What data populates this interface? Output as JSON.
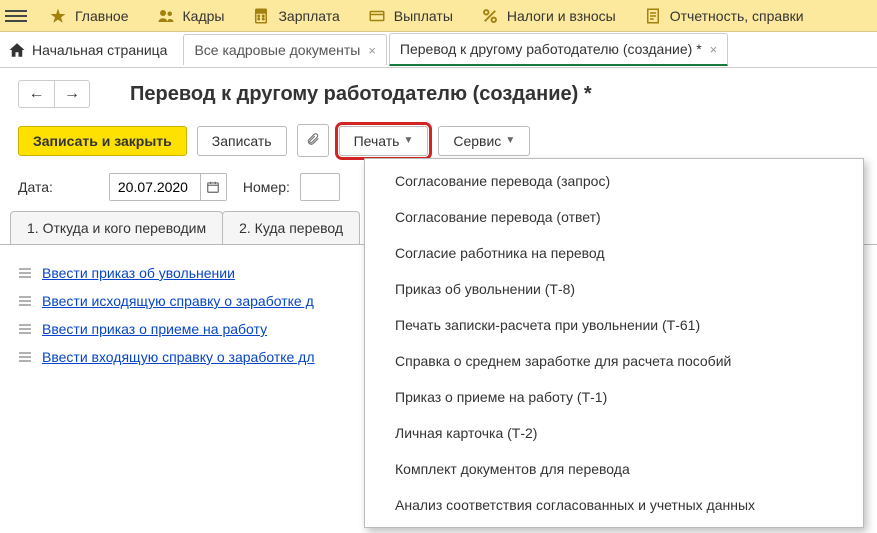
{
  "topmenu": {
    "items": [
      {
        "label": "Главное"
      },
      {
        "label": "Кадры"
      },
      {
        "label": "Зарплата"
      },
      {
        "label": "Выплаты"
      },
      {
        "label": "Налоги и взносы"
      },
      {
        "label": "Отчетность, справки"
      }
    ]
  },
  "tabs": {
    "start": "Начальная страница",
    "items": [
      {
        "label": "Все кадровые документы"
      },
      {
        "label": "Перевод к другому работодателю (создание) *"
      }
    ]
  },
  "page": {
    "title": "Перевод к другому работодателю (создание) *"
  },
  "toolbar": {
    "save_close": "Записать и закрыть",
    "save": "Записать",
    "print": "Печать",
    "service": "Сервис"
  },
  "form": {
    "date_label": "Дата:",
    "date_value": "20.07.2020",
    "number_label": "Номер:",
    "number_value": ""
  },
  "content_tabs": {
    "items": [
      {
        "label": "1. Откуда и кого переводим"
      },
      {
        "label": "2. Куда перевод"
      }
    ]
  },
  "links": {
    "items": [
      {
        "label": "Ввести приказ об увольнении"
      },
      {
        "label": "Ввести исходящую справку о заработке д"
      },
      {
        "label": "Ввести приказ о приеме на работу"
      },
      {
        "label": "Ввести входящую справку о заработке дл"
      }
    ]
  },
  "print_menu": {
    "items": [
      {
        "label": "Согласование перевода (запрос)"
      },
      {
        "label": "Согласование перевода (ответ)"
      },
      {
        "label": "Согласие работника на перевод"
      },
      {
        "label": "Приказ об увольнении (Т-8)"
      },
      {
        "label": "Печать записки-расчета при увольнении (Т-61)"
      },
      {
        "label": "Справка о среднем заработке для расчета пособий"
      },
      {
        "label": "Приказ о приеме на работу (Т-1)"
      },
      {
        "label": "Личная карточка (Т-2)"
      },
      {
        "label": "Комплект документов для перевода"
      },
      {
        "label": "Анализ соответствия согласованных и учетных данных"
      }
    ]
  }
}
